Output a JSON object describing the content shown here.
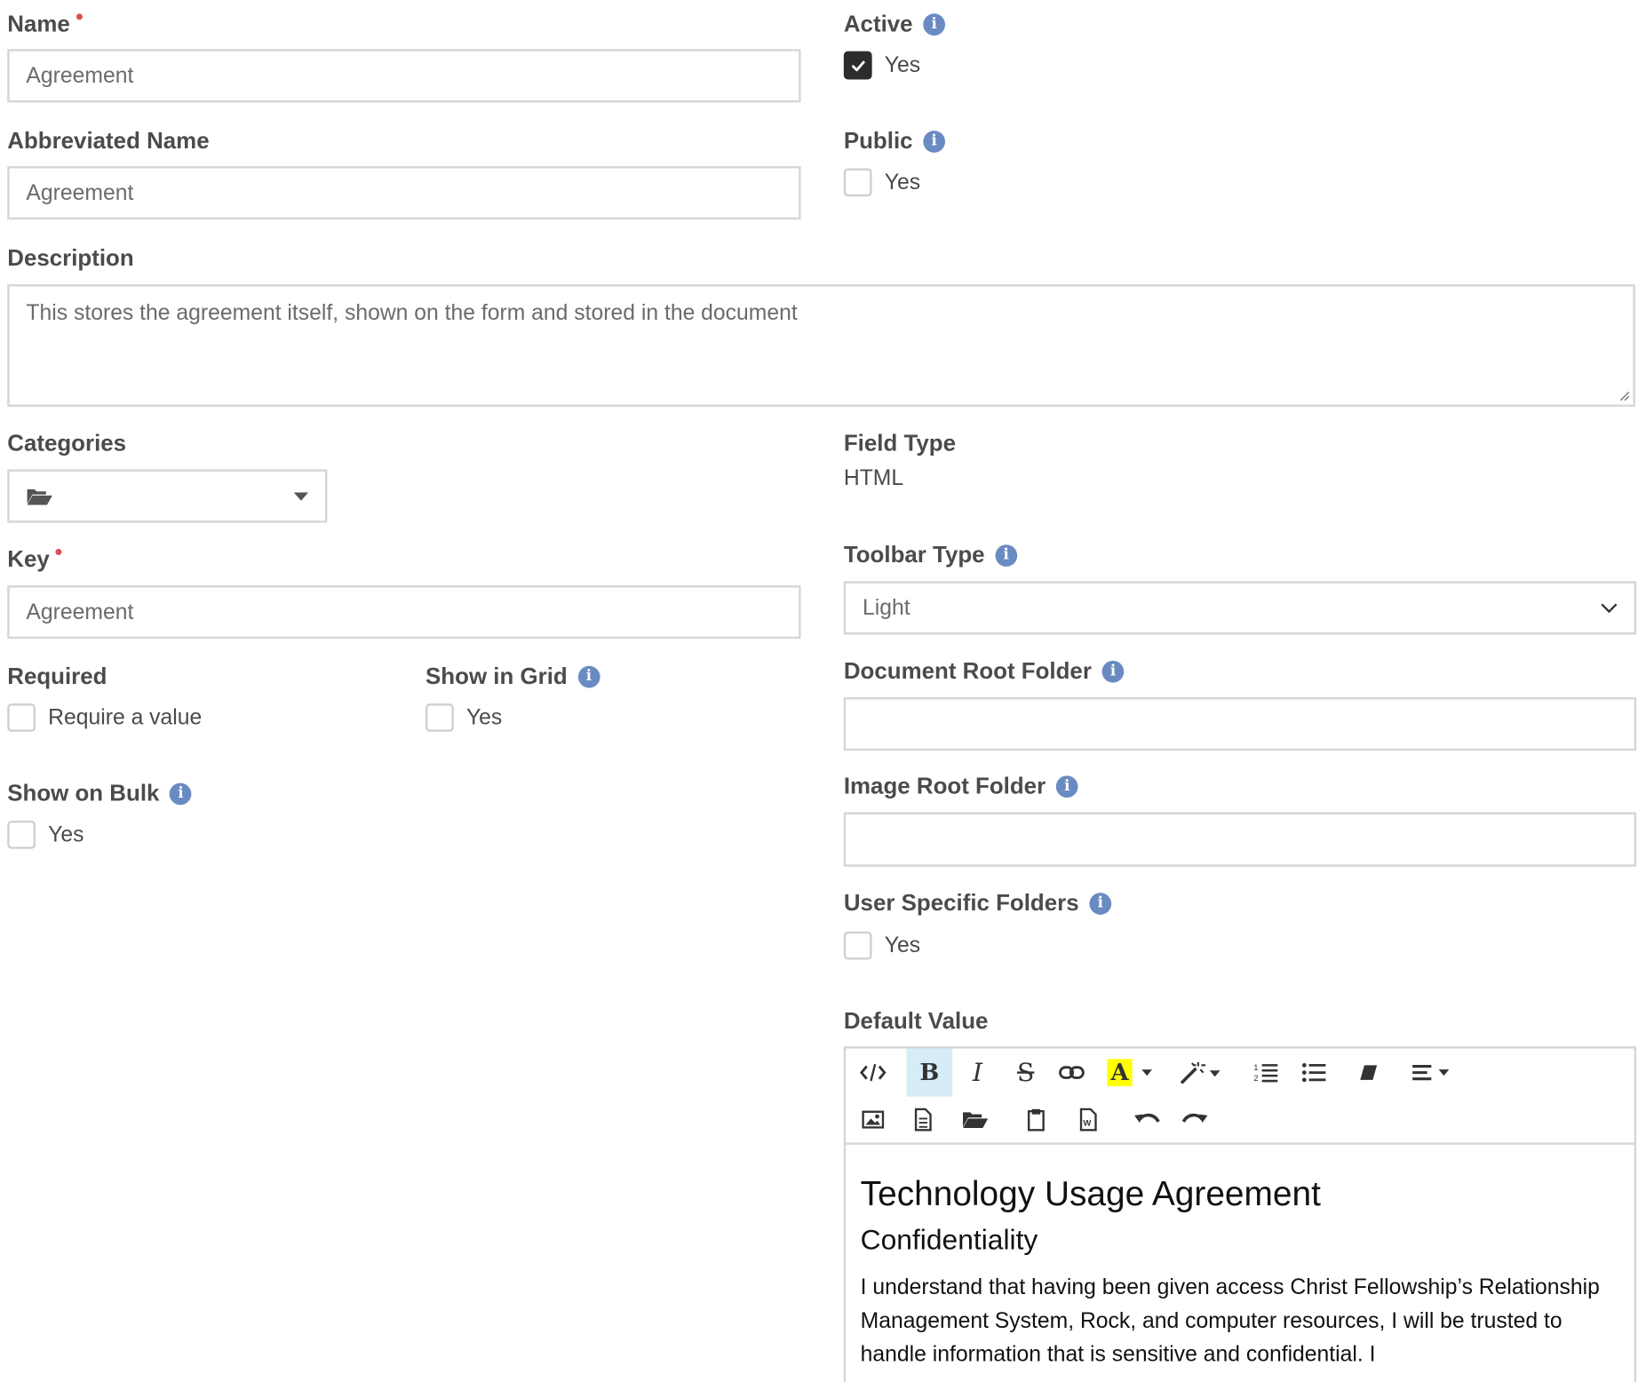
{
  "form": {
    "name": {
      "label": "Name",
      "value": "Agreement"
    },
    "abbreviated_name": {
      "label": "Abbreviated Name",
      "value": "Agreement"
    },
    "description": {
      "label": "Description",
      "value": "This stores the agreement itself, shown on the form and stored in the document"
    },
    "categories": {
      "label": "Categories",
      "icon": "folder-open-icon"
    },
    "key": {
      "label": "Key",
      "value": "Agreement"
    },
    "required": {
      "label": "Required",
      "option": "Require a value",
      "checked": false
    },
    "show_in_grid": {
      "label": "Show in Grid",
      "option": "Yes",
      "checked": false
    },
    "show_on_bulk": {
      "label": "Show on Bulk",
      "option": "Yes",
      "checked": false
    },
    "active": {
      "label": "Active",
      "option": "Yes",
      "checked": true
    },
    "public": {
      "label": "Public",
      "option": "Yes",
      "checked": false
    },
    "field_type": {
      "label": "Field Type",
      "value": "HTML"
    },
    "toolbar_type": {
      "label": "Toolbar Type",
      "value": "Light"
    },
    "document_root_folder": {
      "label": "Document Root Folder",
      "value": ""
    },
    "image_root_folder": {
      "label": "Image Root Folder",
      "value": ""
    },
    "user_specific_folders": {
      "label": "User Specific Folders",
      "option": "Yes",
      "checked": false
    },
    "default_value": {
      "label": "Default Value",
      "toolbar_row1": [
        "code-view-icon",
        "bold-icon",
        "italic-icon",
        "strikethrough-icon",
        "link-icon",
        "font-color-icon",
        "dropdown-caret-icon",
        "magic-wand-icon",
        "ordered-list-icon",
        "unordered-list-icon",
        "eraser-icon",
        "align-icon"
      ],
      "toolbar_row2": [
        "image-icon",
        "file-icon",
        "folder-open-icon",
        "clipboard-icon",
        "word-file-icon",
        "undo-icon",
        "redo-icon"
      ],
      "heading1": "Technology Usage Agreement",
      "heading2": "Confidentiality",
      "paragraph": "I understand that having been given access Christ Fellowship’s Relationship Management System, Rock, and computer resources, I will be trusted to handle information that is sensitive and confidential. I"
    }
  },
  "colors": {
    "accent_info": "#6a8bc2",
    "required_dot": "#d9534f",
    "active_toolbar_button": "#d6ecf6"
  }
}
